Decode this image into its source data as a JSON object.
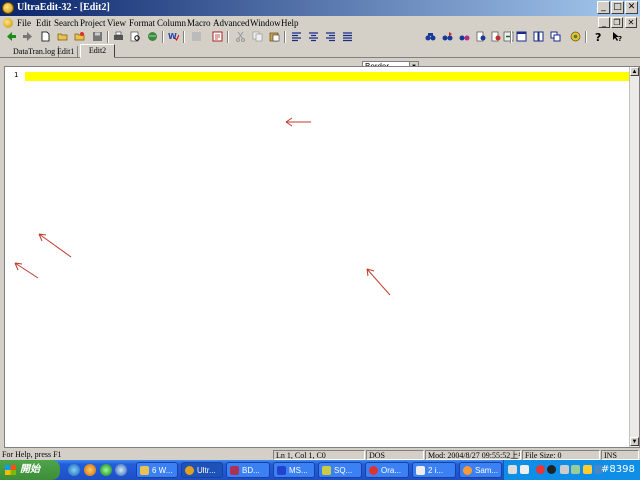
{
  "window": {
    "title": "UltraEdit-32 - [Edit2]",
    "minimize_glyph": "_",
    "maximize_glyph": "□",
    "close_glyph": "✕"
  },
  "menubar": {
    "items": [
      "File",
      "Edit",
      "Search",
      "Project",
      "View",
      "Format",
      "Column",
      "Macro",
      "Advanced",
      "Window",
      "Help"
    ],
    "mdi_minimize_glyph": "_",
    "mdi_restore_glyph": "❐",
    "mdi_close_glyph": "✕"
  },
  "toolbar": {
    "border_select_value": "Border",
    "icons": [
      "back-icon",
      "forward-icon",
      "new-file-icon",
      "open-folder-icon",
      "open-folder-alt-icon",
      "save-icon",
      "print-icon",
      "print-preview-icon",
      "web-icon",
      "spell-check-icon",
      "properties-icon",
      "toggle-icon",
      "cut-icon",
      "copy-icon",
      "paste-icon",
      "align-left-icon",
      "align-center-icon",
      "align-right-icon",
      "justify-icon",
      "find-icon",
      "find-next-icon",
      "replace-icon",
      "find-in-files-icon",
      "replace-in-files-icon",
      "goto-icon",
      "window-list-icon",
      "tile-icon",
      "cascade-icon",
      "tools-icon",
      "help-icon",
      "context-help-icon"
    ]
  },
  "tabs": [
    "DataTran.log",
    "Edit1",
    "Edit2"
  ],
  "active_tab": "Edit2",
  "editor": {
    "line_number": "1",
    "scroll_up_glyph": "▲",
    "scroll_down_glyph": "▼"
  },
  "statusbar": {
    "help": "For Help, press F1",
    "position": "Ln 1, Col 1, C0",
    "format": "DOS",
    "modified": "Mod: 2004/8/27 09:55:52上午",
    "file_size": "File Size: 0",
    "mode": "INS"
  },
  "taskbar": {
    "start_label": "開始",
    "tasks": [
      "6 W...",
      "Ultr...",
      "BD...",
      "MS...",
      "SQ...",
      "Ora...",
      "2 i...",
      "Sam..."
    ],
    "clock": "#8398"
  },
  "colors": {
    "title_gradient_start": "#0a246a",
    "line_highlight": "#ffff00",
    "annotation_arrow": "#c0392b",
    "taskbar": "#245edb"
  }
}
